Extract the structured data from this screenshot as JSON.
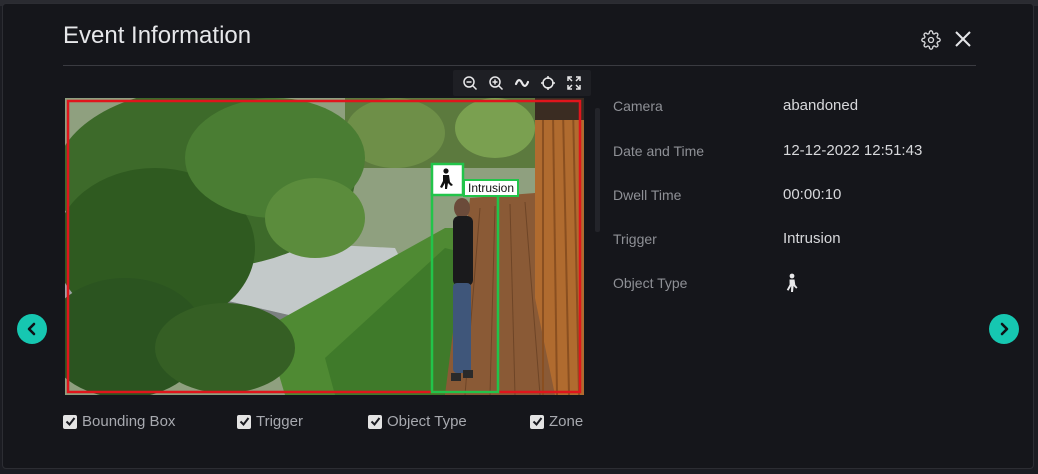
{
  "modal": {
    "title": "Event Information"
  },
  "toolbar": {
    "tools": [
      "zoom-out-icon",
      "zoom-in-icon",
      "wave-icon",
      "crosshair-icon",
      "expand-icon"
    ]
  },
  "viewer": {
    "detection_label": "Intrusion"
  },
  "checkboxes": {
    "bounding_box": "Bounding Box",
    "trigger": "Trigger",
    "object_type": "Object Type",
    "zone": "Zone"
  },
  "info": {
    "camera_label": "Camera",
    "camera_value": "abandoned",
    "datetime_label": "Date and Time",
    "datetime_value": "12-12-2022 12:51:43",
    "dwell_label": "Dwell Time",
    "dwell_value": "00:00:10",
    "trigger_label": "Trigger",
    "trigger_value": "Intrusion",
    "object_label": "Object Type",
    "object_icon": "person-walking-icon"
  },
  "colors": {
    "accent": "#16c7b1",
    "zone_red": "#e0151c",
    "detection_green": "#22c44a"
  }
}
